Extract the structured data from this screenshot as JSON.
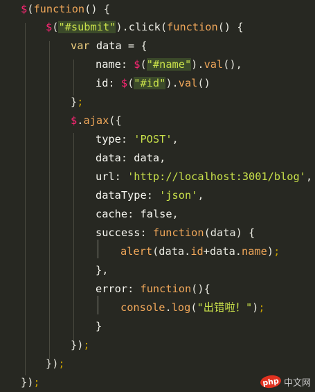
{
  "code": {
    "lines": [
      [
        {
          "t": "$",
          "c": "t-dollar"
        },
        {
          "t": "(",
          "c": "t-pun"
        },
        {
          "t": "function",
          "c": "t-func"
        },
        {
          "t": "() {",
          "c": "t-pun"
        }
      ],
      [
        {
          "t": "$",
          "c": "t-dollar"
        },
        {
          "t": "(",
          "c": "t-pun"
        },
        {
          "t": "\"#submit\"",
          "c": "t-str sel"
        },
        {
          "t": ").",
          "c": "t-pun"
        },
        {
          "t": "click",
          "c": "t-method"
        },
        {
          "t": "(",
          "c": "t-pun"
        },
        {
          "t": "function",
          "c": "t-func"
        },
        {
          "t": "() {",
          "c": "t-pun"
        }
      ],
      [
        {
          "t": "var ",
          "c": "t-kw"
        },
        {
          "t": "data ",
          "c": "t-var"
        },
        {
          "t": "= {",
          "c": "t-pun"
        }
      ],
      [
        {
          "t": "name",
          "c": "t-prop"
        },
        {
          "t": ": ",
          "c": "t-pun"
        },
        {
          "t": "$",
          "c": "t-dollar"
        },
        {
          "t": "(",
          "c": "t-pun"
        },
        {
          "t": "\"#name\"",
          "c": "t-str sel"
        },
        {
          "t": ").",
          "c": "t-pun"
        },
        {
          "t": "val",
          "c": "t-fn"
        },
        {
          "t": "(),",
          "c": "t-pun"
        }
      ],
      [
        {
          "t": "id",
          "c": "t-prop"
        },
        {
          "t": ": ",
          "c": "t-pun"
        },
        {
          "t": "$",
          "c": "t-dollar"
        },
        {
          "t": "(",
          "c": "t-pun"
        },
        {
          "t": "\"#id\"",
          "c": "t-str sel"
        },
        {
          "t": ").",
          "c": "t-pun"
        },
        {
          "t": "val",
          "c": "t-fn"
        },
        {
          "t": "()",
          "c": "t-pun"
        }
      ],
      [
        {
          "t": "}",
          "c": "t-pun"
        },
        {
          "t": ";",
          "c": "t-semi"
        }
      ],
      [
        {
          "t": "$",
          "c": "t-dollar"
        },
        {
          "t": ".",
          "c": "t-pun"
        },
        {
          "t": "ajax",
          "c": "t-fn"
        },
        {
          "t": "({",
          "c": "t-pun"
        }
      ],
      [
        {
          "t": "type",
          "c": "t-prop"
        },
        {
          "t": ": ",
          "c": "t-pun"
        },
        {
          "t": "'POST'",
          "c": "t-str"
        },
        {
          "t": ",",
          "c": "t-pun"
        }
      ],
      [
        {
          "t": "data",
          "c": "t-prop"
        },
        {
          "t": ": ",
          "c": "t-pun"
        },
        {
          "t": "data",
          "c": "t-var"
        },
        {
          "t": ",",
          "c": "t-pun"
        }
      ],
      [
        {
          "t": "url",
          "c": "t-prop"
        },
        {
          "t": ": ",
          "c": "t-pun"
        },
        {
          "t": "'http://localhost:3001/blog'",
          "c": "t-str"
        },
        {
          "t": ",",
          "c": "t-pun"
        }
      ],
      [
        {
          "t": "dataType",
          "c": "t-prop"
        },
        {
          "t": ": ",
          "c": "t-pun"
        },
        {
          "t": "'json'",
          "c": "t-str"
        },
        {
          "t": ",",
          "c": "t-pun"
        }
      ],
      [
        {
          "t": "cache",
          "c": "t-prop"
        },
        {
          "t": ": ",
          "c": "t-pun"
        },
        {
          "t": "false",
          "c": "t-bool"
        },
        {
          "t": ",",
          "c": "t-pun"
        }
      ],
      [
        {
          "t": "success",
          "c": "t-prop"
        },
        {
          "t": ": ",
          "c": "t-pun"
        },
        {
          "t": "function",
          "c": "t-func"
        },
        {
          "t": "(data) {",
          "c": "t-pun"
        }
      ],
      [
        {
          "t": "alert",
          "c": "t-fn"
        },
        {
          "t": "(data.",
          "c": "t-pun"
        },
        {
          "t": "id",
          "c": "t-fn"
        },
        {
          "t": "+data.",
          "c": "t-pun"
        },
        {
          "t": "name",
          "c": "t-fn"
        },
        {
          "t": ")",
          "c": "t-pun"
        },
        {
          "t": ";",
          "c": "t-semi"
        }
      ],
      [
        {
          "t": "},",
          "c": "t-pun"
        }
      ],
      [
        {
          "t": "error",
          "c": "t-prop"
        },
        {
          "t": ": ",
          "c": "t-pun"
        },
        {
          "t": "function",
          "c": "t-func"
        },
        {
          "t": "(){",
          "c": "t-pun"
        }
      ],
      [
        {
          "t": "console",
          "c": "t-fn"
        },
        {
          "t": ".",
          "c": "t-pun"
        },
        {
          "t": "log",
          "c": "t-fn"
        },
        {
          "t": "(",
          "c": "t-pun"
        },
        {
          "t": "\"出错啦！\"",
          "c": "t-str"
        },
        {
          "t": ")",
          "c": "t-pun"
        },
        {
          "t": ";",
          "c": "t-semi"
        }
      ],
      [
        {
          "t": "}",
          "c": "t-pun"
        }
      ],
      [
        {
          "t": "})",
          "c": "t-pun"
        },
        {
          "t": ";",
          "c": "t-semi"
        }
      ],
      [
        {
          "t": "})",
          "c": "t-pun"
        },
        {
          "t": ";",
          "c": "t-semi"
        }
      ],
      [
        {
          "t": "})",
          "c": "t-pun"
        },
        {
          "t": ";",
          "c": "t-semi"
        }
      ]
    ]
  },
  "watermark": {
    "logo_text": "php",
    "site_text": "中文网"
  },
  "colors": {
    "background": "#272822",
    "string": "#c8e04a",
    "dollar": "#f92672",
    "keyword": "#f0d080",
    "function": "#f2a85a",
    "semicolon": "#c8a000"
  }
}
